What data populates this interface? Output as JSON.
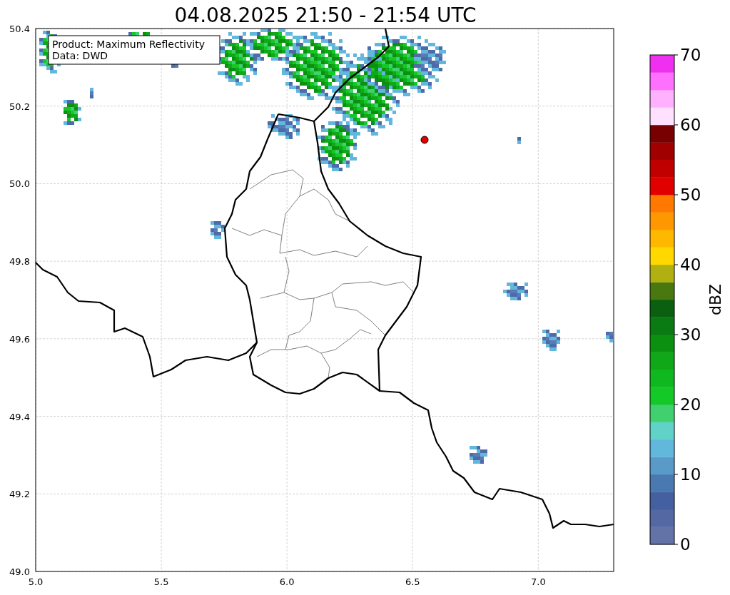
{
  "title": "04.08.2025 21:50 - 21:54 UTC",
  "info_box": [
    "Product: Maximum Reflectivity",
    "Data: DWD"
  ],
  "map": {
    "x_ticks": [
      "5.0",
      "5.5",
      "6.0",
      "6.5",
      "7.0"
    ],
    "y_ticks": [
      "50.4",
      "50.2",
      "50.0",
      "49.8",
      "49.6",
      "49.4",
      "49.2",
      "49.0"
    ]
  },
  "colorbar": {
    "label": "dBZ",
    "ticks": [
      "70",
      "60",
      "50",
      "40",
      "30",
      "20",
      "10",
      "0"
    ],
    "segments": [
      {
        "color": "#6373a7"
      },
      {
        "color": "#5468a3"
      },
      {
        "color": "#4560a0"
      },
      {
        "color": "#4a78b0"
      },
      {
        "color": "#5a9ac8"
      },
      {
        "color": "#62b8dc"
      },
      {
        "color": "#60d2c8"
      },
      {
        "color": "#40d070"
      },
      {
        "color": "#14c828"
      },
      {
        "color": "#10b820"
      },
      {
        "color": "#10a818"
      },
      {
        "color": "#0c9010"
      },
      {
        "color": "#0a7a12"
      },
      {
        "color": "#0a6010"
      },
      {
        "color": "#4a7810"
      },
      {
        "color": "#b0b010"
      },
      {
        "color": "#ffd800"
      },
      {
        "color": "#ffb800"
      },
      {
        "color": "#ff9800"
      },
      {
        "color": "#ff7800"
      },
      {
        "color": "#e00000"
      },
      {
        "color": "#c00000"
      },
      {
        "color": "#a00000"
      },
      {
        "color": "#780000"
      },
      {
        "color": "#ffe0ff"
      },
      {
        "color": "#ffb0ff"
      },
      {
        "color": "#ff70ff"
      },
      {
        "color": "#f030f0"
      }
    ]
  }
}
